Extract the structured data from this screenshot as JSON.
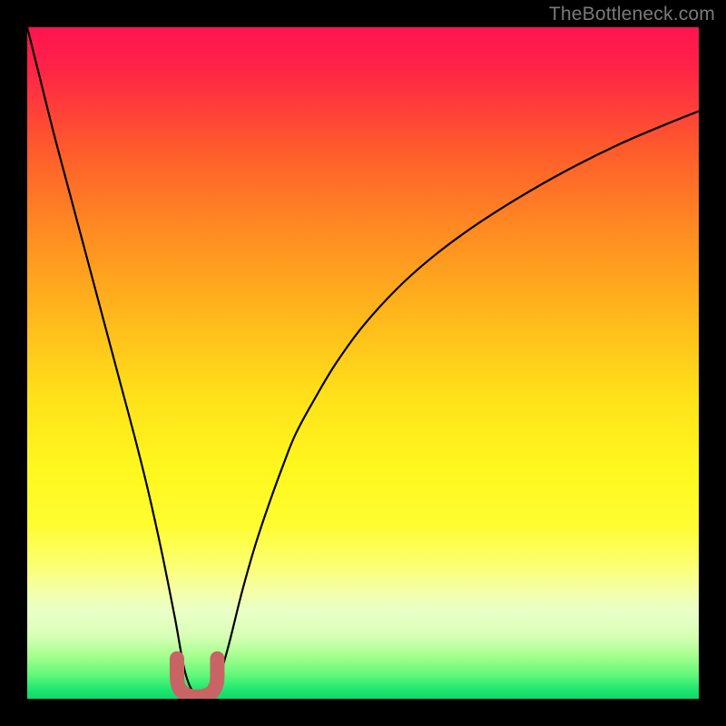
{
  "watermark": "TheBottleneck.com",
  "colors": {
    "frame": "#000000",
    "watermark_text": "#7a7a7a",
    "curve": "#000000",
    "marker": "#c86464",
    "gradient_stops": [
      {
        "offset": 0.0,
        "color": "#ff1450"
      },
      {
        "offset": 0.06,
        "color": "#ff2347"
      },
      {
        "offset": 0.18,
        "color": "#ff5a2c"
      },
      {
        "offset": 0.3,
        "color": "#ff8a22"
      },
      {
        "offset": 0.42,
        "color": "#ffb41c"
      },
      {
        "offset": 0.55,
        "color": "#ffe11a"
      },
      {
        "offset": 0.66,
        "color": "#fff81e"
      },
      {
        "offset": 0.74,
        "color": "#fffc30"
      },
      {
        "offset": 0.8,
        "color": "#fcff70"
      },
      {
        "offset": 0.84,
        "color": "#f4ffa8"
      },
      {
        "offset": 0.87,
        "color": "#eaffc8"
      },
      {
        "offset": 0.905,
        "color": "#d8ffb8"
      },
      {
        "offset": 0.935,
        "color": "#a8ff90"
      },
      {
        "offset": 0.965,
        "color": "#60f878"
      },
      {
        "offset": 0.985,
        "color": "#20e870"
      },
      {
        "offset": 1.0,
        "color": "#10d868"
      }
    ]
  },
  "chart_data": {
    "type": "line",
    "title": "",
    "xlabel": "",
    "ylabel": "",
    "xlim": [
      0,
      100
    ],
    "ylim": [
      0,
      100
    ],
    "grid": false,
    "note": "Y maps to vertical position; 0 = bottom (green), 100 = top (red). Curve estimated from pixels; x/y are percentages of plot area.",
    "series": [
      {
        "name": "bottleneck-curve",
        "x": [
          0,
          2,
          4,
          6,
          8,
          10,
          12,
          14,
          16,
          18,
          20,
          22,
          23.5,
          25,
          26,
          27,
          28.5,
          30,
          32,
          34,
          36,
          38,
          40,
          43,
          46,
          50,
          55,
          60,
          66,
          73,
          80,
          88,
          95,
          100
        ],
        "y": [
          100,
          92,
          84,
          76.5,
          69,
          61.5,
          54,
          46.5,
          39,
          31,
          22,
          12,
          4,
          0.5,
          0.2,
          0.5,
          3,
          8,
          16,
          23,
          29,
          34.5,
          39.5,
          45,
          50,
          55.5,
          61,
          65.5,
          70,
          74.5,
          78.5,
          82.5,
          85.5,
          87.5
        ]
      }
    ],
    "marker": {
      "name": "optimal-range",
      "shape": "U",
      "x_range": [
        22.3,
        28.3
      ],
      "y_bottom": 0.3,
      "y_top": 6.0,
      "color": "#c86464"
    }
  }
}
